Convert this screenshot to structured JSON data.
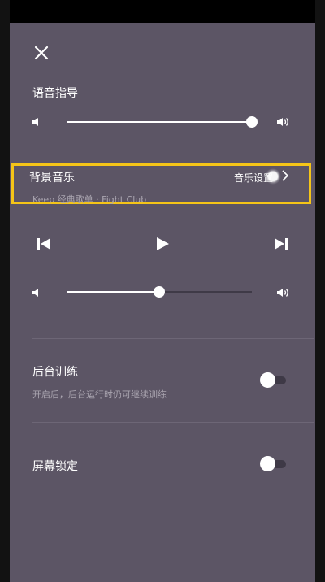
{
  "voice_guide": {
    "title": "语音指导",
    "volume_level": 1.0
  },
  "background_music": {
    "title": "背景音乐",
    "settings_label": "音乐设置",
    "playlist": "Keep 经典歌单 · Fight Club",
    "highlight_color": "#f5c518",
    "volume_level": 0.5
  },
  "player": {
    "controls": [
      "previous-track-icon",
      "play-icon",
      "next-track-icon"
    ]
  },
  "background_training": {
    "title": "后台训练",
    "description": "开启后，后台运行时仍可继续训练",
    "enabled": false
  },
  "screen_lock": {
    "title": "屏幕锁定",
    "enabled": false
  },
  "colors": {
    "background": "#5c5565",
    "accent": "#f5c518",
    "track": "#3f3a47"
  }
}
